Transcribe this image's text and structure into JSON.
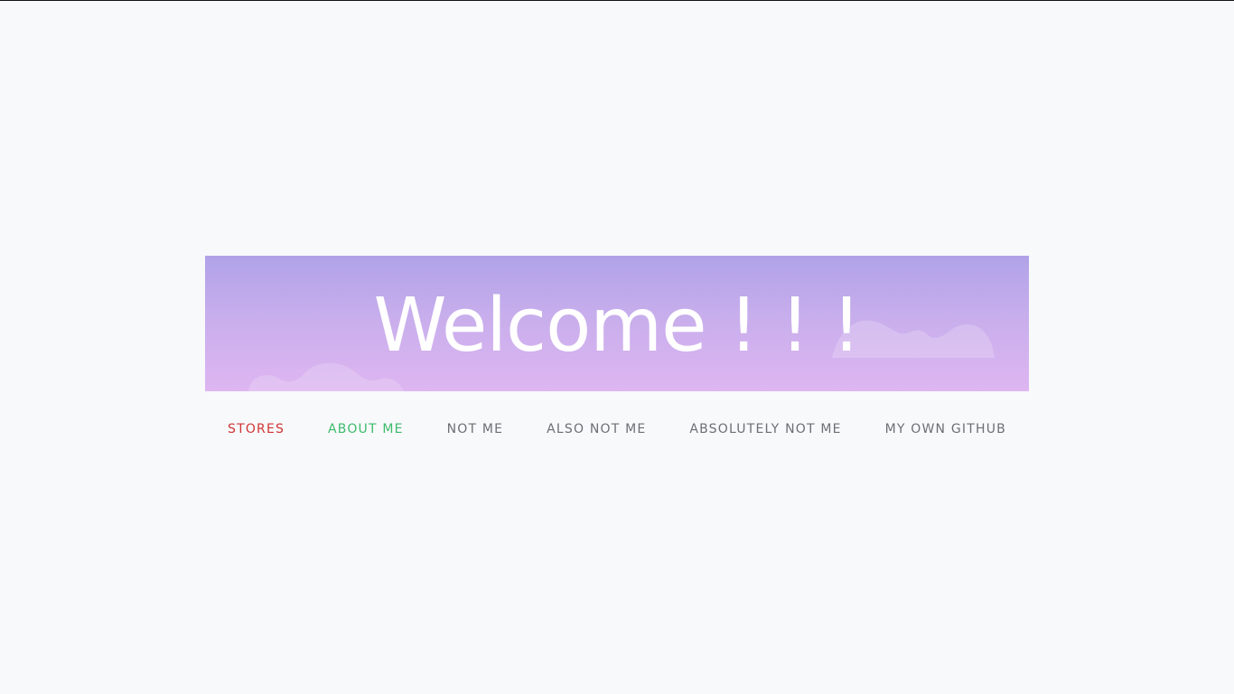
{
  "banner": {
    "heading": "Welcome ! ! !",
    "gradient_top": "#b0a2e8",
    "gradient_bottom": "#deb6f1"
  },
  "nav": {
    "items": [
      {
        "label": "STORES",
        "color": "#d03535"
      },
      {
        "label": "ABOUT ME",
        "color": "#3dbb6c"
      },
      {
        "label": "NOT ME",
        "color": "#6c6f73"
      },
      {
        "label": "ALSO NOT ME",
        "color": "#6c6f73"
      },
      {
        "label": "ABSOLUTELY NOT ME",
        "color": "#6c6f73"
      },
      {
        "label": "MY OWN GITHUB",
        "color": "#6c6f73"
      }
    ]
  }
}
